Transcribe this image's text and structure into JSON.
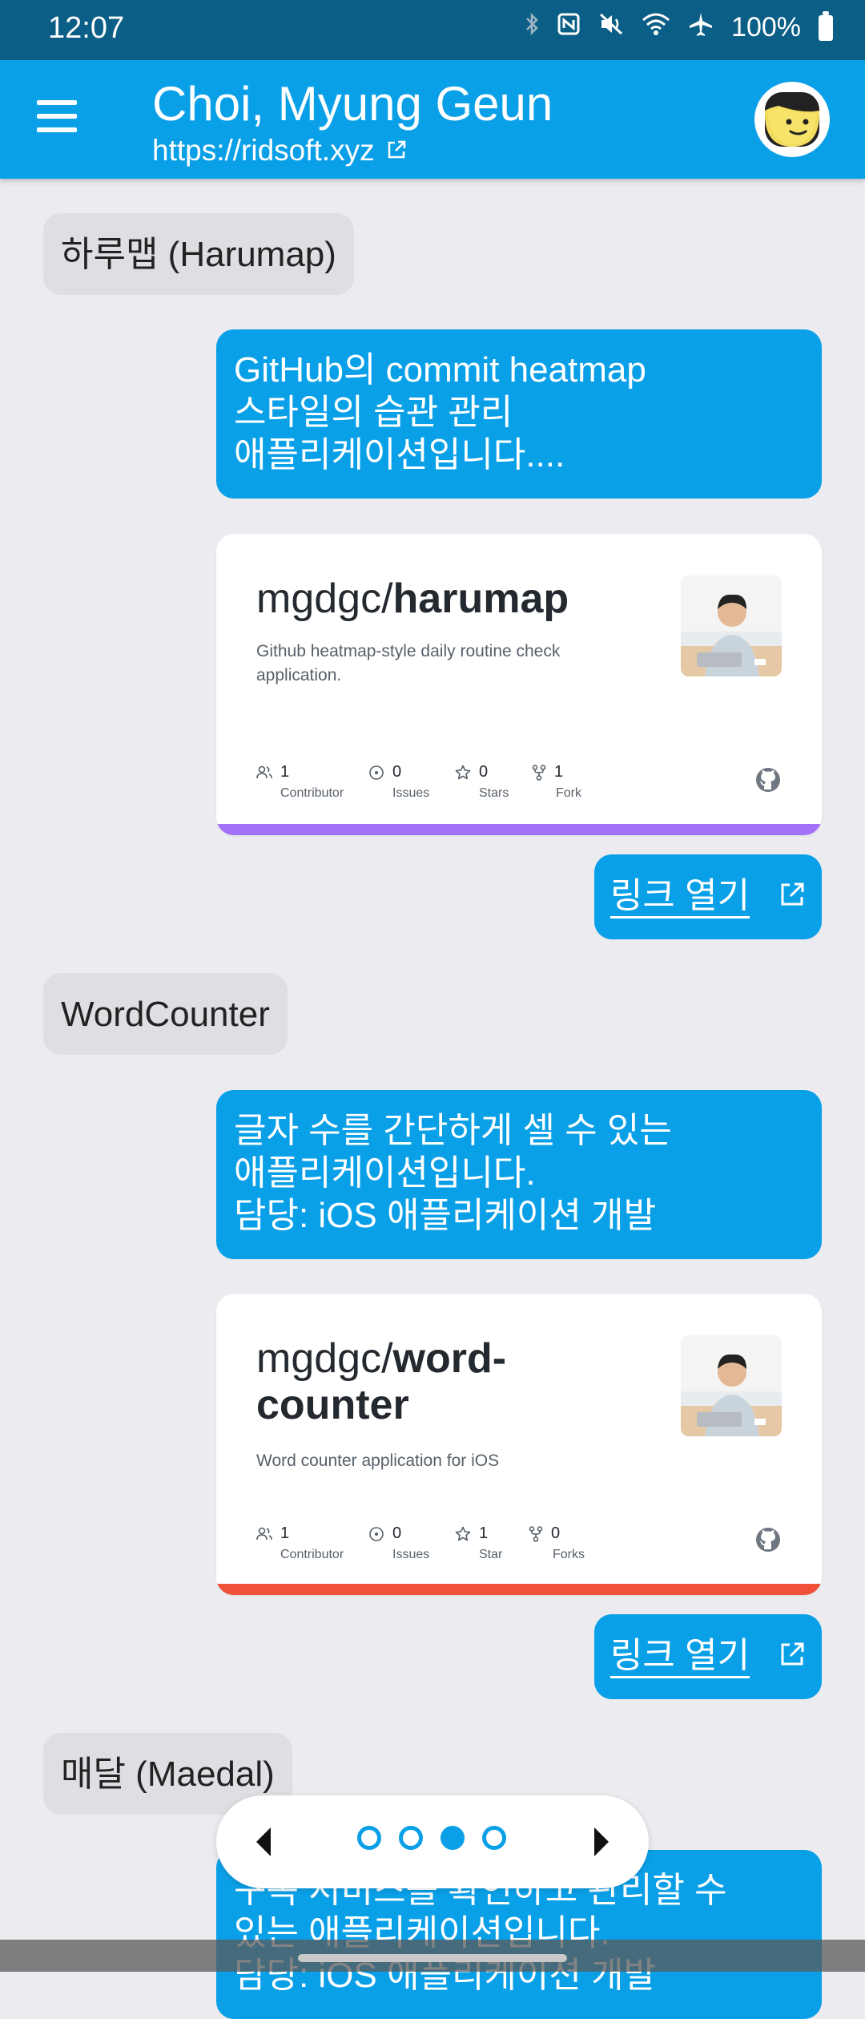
{
  "status": {
    "time": "12:07",
    "battery": "100%",
    "icons": [
      "bluetooth-icon",
      "nfc-icon",
      "vibrate-off-icon",
      "wifi-icon",
      "airplane-icon",
      "battery-icon"
    ]
  },
  "header": {
    "title": "Choi, Myung Geun",
    "url": "https://ridsoft.xyz"
  },
  "messages": {
    "m1_title": "하루맵 (Harumap)",
    "m1_desc": [
      "GitHub의 commit heatmap",
      "스타일의 습관 관리",
      "애플리케이션입니다...."
    ],
    "m2_title": "WordCounter",
    "m2_desc": [
      "글자 수를 간단하게 셀 수 있는",
      "애플리케이션입니다.",
      "담당: iOS 애플리케이션 개발"
    ],
    "m3_title": "매달 (Maedal)",
    "m3_desc": [
      "구독 서비스를 확인하고 관리할 수",
      "있는 애플리케이션입니다.",
      "담당: iOS 애플리케이션 개발"
    ]
  },
  "cards": [
    {
      "owner": "mgdgc/",
      "repo": "harumap",
      "description": "Github heatmap-style daily routine check application.",
      "stats": [
        {
          "value": "1",
          "label": "Contributor"
        },
        {
          "value": "0",
          "label": "Issues"
        },
        {
          "value": "0",
          "label": "Stars"
        },
        {
          "value": "1",
          "label": "Fork"
        }
      ],
      "strip_color": "#a371f7"
    },
    {
      "owner": "mgdgc/",
      "repo": "word-counter",
      "description": "Word counter application for iOS",
      "stats": [
        {
          "value": "1",
          "label": "Contributor"
        },
        {
          "value": "0",
          "label": "Issues"
        },
        {
          "value": "1",
          "label": "Star"
        },
        {
          "value": "0",
          "label": "Forks"
        }
      ],
      "strip_color": "#f05138"
    }
  ],
  "link_button_label": "링크 열기",
  "pager": {
    "page_count": 4,
    "active_index": 2
  },
  "colors": {
    "accent": "#0aa0e8",
    "status_bar": "#0b5e85",
    "background": "#ececf0"
  }
}
